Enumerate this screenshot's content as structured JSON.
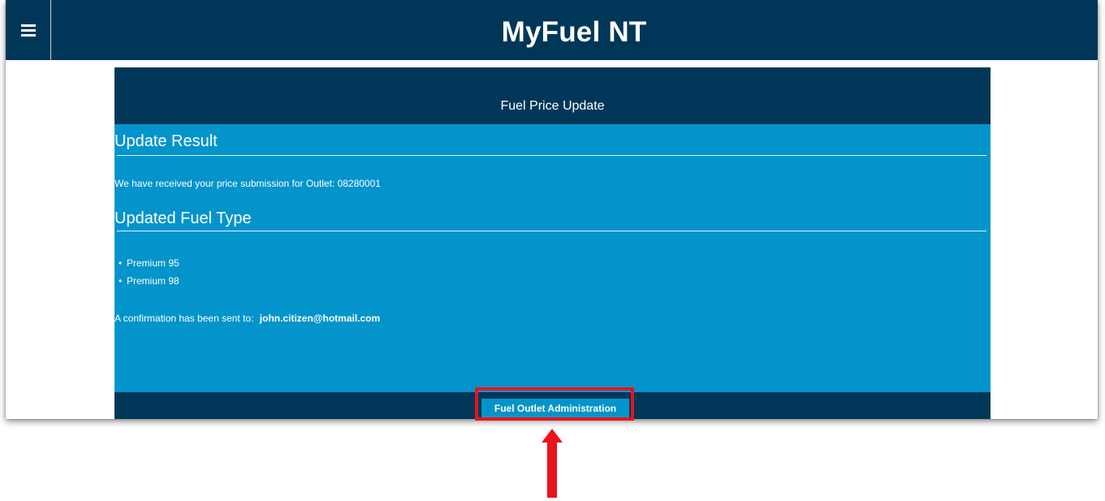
{
  "app": {
    "title": "MyFuel NT",
    "menu_icon": "hamburger-menu-icon"
  },
  "panel": {
    "header": "Fuel Price Update",
    "update_result": {
      "heading": "Update Result",
      "message": "We have received your price submission for Outlet: 08280001"
    },
    "updated_fuel_type": {
      "heading": "Updated Fuel Type",
      "items": [
        "Premium 95",
        "Premium 98"
      ]
    },
    "confirmation": {
      "label": "A confirmation has been sent to:",
      "email": "john.citizen@hotmail.com"
    },
    "footer": {
      "button_label": "Fuel Outlet Administration"
    }
  },
  "annotation": {
    "highlight_color": "#e8141b",
    "arrow_icon": "up-arrow-icon"
  },
  "colors": {
    "navy": "#003758",
    "blue": "#0394cc",
    "text": "#ffffff"
  }
}
